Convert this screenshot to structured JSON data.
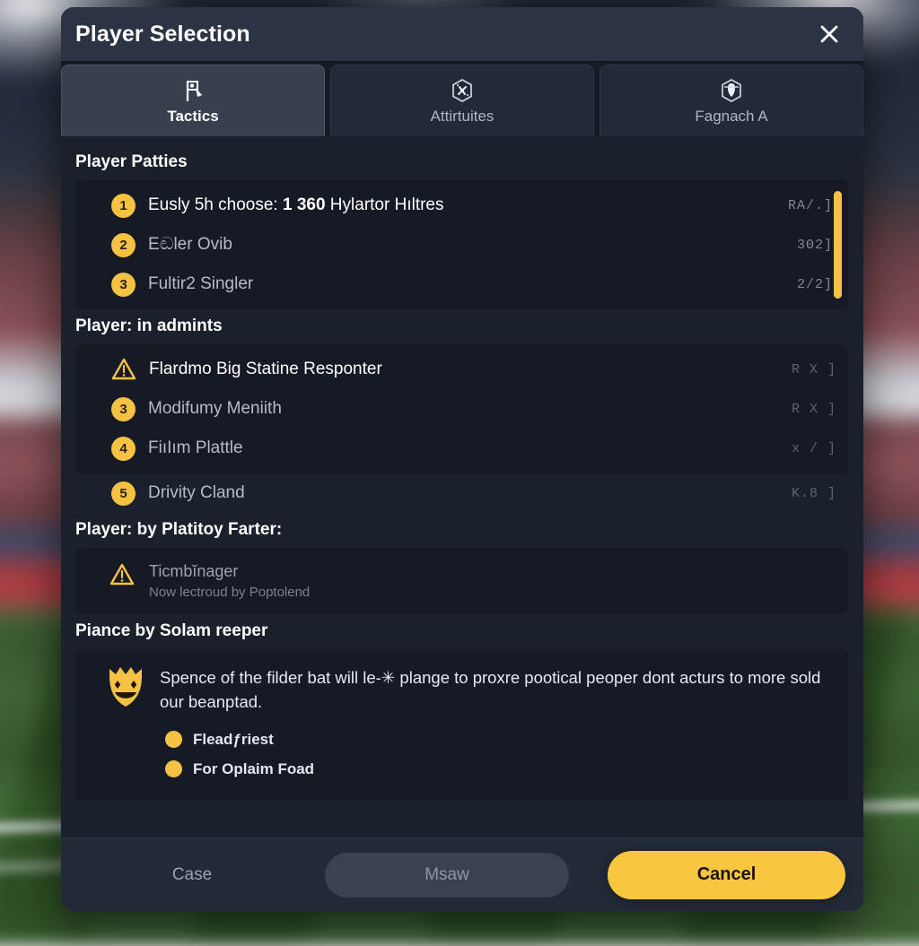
{
  "window": {
    "title": "Player Selection",
    "close_icon": "close-icon"
  },
  "tabs": [
    {
      "label": "Tactics",
      "icon": "flag-clipboard-icon",
      "active": true
    },
    {
      "label": "Attirtuites",
      "icon": "hex-compass-icon",
      "active": false
    },
    {
      "label": "Fagnach A",
      "icon": "hex-shield-icon",
      "active": false
    }
  ],
  "sections": [
    {
      "title": "Player Patties",
      "rows": [
        {
          "badge": "1",
          "icon": "number-badge",
          "label_pre": "Eusly 5h choose: ",
          "label_bold": "1 360",
          "label_post": " Hylartor Hıltres",
          "value": "RA/.]"
        },
        {
          "badge": "2",
          "icon": "number-badge",
          "label": "Eඬler Ovib",
          "value": "3Θ2]"
        },
        {
          "badge": "3",
          "icon": "number-badge",
          "label": "Fultir2 Singler",
          "value": "2/2]"
        }
      ],
      "scrollbar": true
    },
    {
      "title": "Player: in admints",
      "rows": [
        {
          "icon": "warning-triangle-icon",
          "label": "Flardmo Big Statine Responter",
          "value": "R X ]",
          "bright": true
        },
        {
          "badge": "3",
          "icon": "number-badge",
          "label": "Modifumy Meniith",
          "value": "R X ]"
        },
        {
          "badge": "4",
          "icon": "number-badge",
          "label": "FiıIım Plattle",
          "value": "x / ]"
        }
      ],
      "outside_rows": [
        {
          "badge": "5",
          "icon": "number-badge",
          "label": "Drivity Cland",
          "value": "K.8 ]"
        }
      ]
    }
  ],
  "notice_section": {
    "title": "Player: by Platitoy Farter:",
    "icon": "warning-triangle-icon",
    "heading": "Ticmbĭnager",
    "subtext": "Now lectroud by Poptolend"
  },
  "info_section": {
    "title": "Piance by Solam reeper",
    "icon": "crown-shield-smiley-icon",
    "paragraph": "Spence of the filder bat will le-✳ plange to proxre pootical peoper dont acturs to more sold our beanptad.",
    "bullets": [
      {
        "label": "Fleadƒriest"
      },
      {
        "label": "For Oplaim Foad"
      }
    ]
  },
  "footer": {
    "tertiary_label": "Case",
    "secondary_label": "Msaw",
    "primary_label": "Cancel"
  },
  "colors": {
    "accent": "#f6c244",
    "primary_button": "#f8c63f",
    "panel": "#151a24",
    "modal": "#1b212c",
    "titlebar": "#2b3442"
  }
}
